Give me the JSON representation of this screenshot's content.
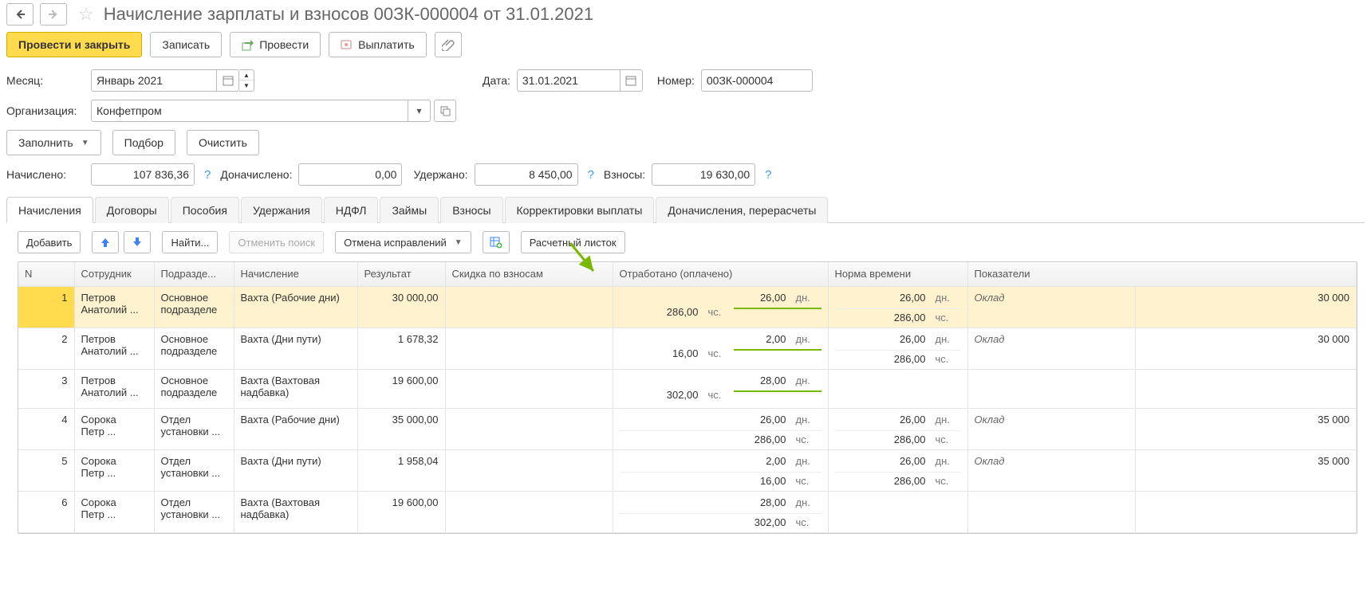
{
  "title": "Начисление зарплаты и взносов 00ЗК-000004 от 31.01.2021",
  "toolbar": {
    "run_close": "Провести и закрыть",
    "save": "Записать",
    "run": "Провести",
    "pay": "Выплатить"
  },
  "form": {
    "month_lbl": "Месяц:",
    "month_val": "Январь 2021",
    "date_lbl": "Дата:",
    "date_val": "31.01.2021",
    "number_lbl": "Номер:",
    "number_val": "00ЗК-000004",
    "org_lbl": "Организация:",
    "org_val": "Конфетпром",
    "fill": "Заполнить",
    "pick": "Подбор",
    "clear": "Очистить",
    "accrued_lbl": "Начислено:",
    "accrued_val": "107 836,36",
    "extra_lbl": "Доначислено:",
    "extra_val": "0,00",
    "withheld_lbl": "Удержано:",
    "withheld_val": "8 450,00",
    "contrib_lbl": "Взносы:",
    "contrib_val": "19 630,00"
  },
  "tabs": [
    "Начисления",
    "Договоры",
    "Пособия",
    "Удержания",
    "НДФЛ",
    "Займы",
    "Взносы",
    "Корректировки выплаты",
    "Доначисления, перерасчеты"
  ],
  "tbl_toolbar": {
    "add": "Добавить",
    "find": "Найти...",
    "cancel_find": "Отменить поиск",
    "undo_edits": "Отмена исправлений",
    "payslip": "Расчетный листок"
  },
  "cols": {
    "n": "N",
    "emp": "Сотрудник",
    "dept": "Подразде...",
    "accrual": "Начисление",
    "result": "Результат",
    "discount": "Скидка по взносам",
    "worked": "Отработано (оплачено)",
    "norm": "Норма времени",
    "indicators": "Показатели"
  },
  "rows": [
    {
      "n": "1",
      "emp1": "Петров",
      "emp2": "Анатолий ...",
      "dept1": "Основное",
      "dept2": "подразделе",
      "acc": "Вахта (Рабочие дни)",
      "res": "30 000,00",
      "w_d": "26,00",
      "w_du": "дн.",
      "w_h": "286,00",
      "w_hu": "чс.",
      "n_d": "26,00",
      "n_du": "дн.",
      "n_h": "286,00",
      "n_hu": "чс.",
      "ind": "Оклад",
      "ind_v": "30 000",
      "hl": true
    },
    {
      "n": "2",
      "emp1": "Петров",
      "emp2": "Анатолий ...",
      "dept1": "Основное",
      "dept2": "подразделе",
      "acc": "Вахта (Дни пути)",
      "res": "1 678,32",
      "w_d": "2,00",
      "w_du": "дн.",
      "w_h": "16,00",
      "w_hu": "чс.",
      "n_d": "26,00",
      "n_du": "дн.",
      "n_h": "286,00",
      "n_hu": "чс.",
      "ind": "Оклад",
      "ind_v": "30 000",
      "hl": true
    },
    {
      "n": "3",
      "emp1": "Петров",
      "emp2": "Анатолий ...",
      "dept1": "Основное",
      "dept2": "подразделе",
      "acc": "Вахта (Вахтовая надбавка)",
      "res": "19 600,00",
      "w_d": "28,00",
      "w_du": "дн.",
      "w_h": "302,00",
      "w_hu": "чс.",
      "n_d": "",
      "n_du": "",
      "n_h": "",
      "n_hu": "",
      "ind": "",
      "ind_v": "",
      "hl": true
    },
    {
      "n": "4",
      "emp1": "Сорока",
      "emp2": "Петр ...",
      "dept1": "Отдел",
      "dept2": "установки ...",
      "acc": "Вахта (Рабочие дни)",
      "res": "35 000,00",
      "w_d": "26,00",
      "w_du": "дн.",
      "w_h": "286,00",
      "w_hu": "чс.",
      "n_d": "26,00",
      "n_du": "дн.",
      "n_h": "286,00",
      "n_hu": "чс.",
      "ind": "Оклад",
      "ind_v": "35 000",
      "hl": false
    },
    {
      "n": "5",
      "emp1": "Сорока",
      "emp2": "Петр ...",
      "dept1": "Отдел",
      "dept2": "установки ...",
      "acc": "Вахта (Дни пути)",
      "res": "1 958,04",
      "w_d": "2,00",
      "w_du": "дн.",
      "w_h": "16,00",
      "w_hu": "чс.",
      "n_d": "26,00",
      "n_du": "дн.",
      "n_h": "286,00",
      "n_hu": "чс.",
      "ind": "Оклад",
      "ind_v": "35 000",
      "hl": false
    },
    {
      "n": "6",
      "emp1": "Сорока",
      "emp2": "Петр ...",
      "dept1": "Отдел",
      "dept2": "установки ...",
      "acc": "Вахта (Вахтовая надбавка)",
      "res": "19 600,00",
      "w_d": "28,00",
      "w_du": "дн.",
      "w_h": "302,00",
      "w_hu": "чс.",
      "n_d": "",
      "n_du": "",
      "n_h": "",
      "n_hu": "",
      "ind": "",
      "ind_v": "",
      "hl": false
    }
  ]
}
